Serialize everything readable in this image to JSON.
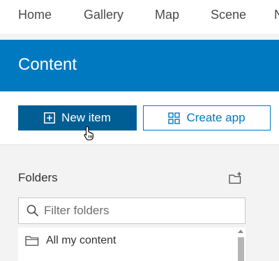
{
  "nav": {
    "items": [
      {
        "label": "Home"
      },
      {
        "label": "Gallery"
      },
      {
        "label": "Map"
      },
      {
        "label": "Scene"
      },
      {
        "label": "N"
      }
    ]
  },
  "banner": {
    "title": "Content"
  },
  "actions": {
    "new_item_label": "New item",
    "new_item_icon": "plus-square-icon",
    "create_app_label": "Create app",
    "create_app_icon": "grid-apps-icon"
  },
  "folders": {
    "heading": "Folders",
    "add_icon": "add-folder-icon",
    "filter_placeholder": "Filter folders",
    "filter_value": "",
    "items": [
      {
        "label": "All my content",
        "icon": "folder-icon"
      }
    ]
  },
  "colors": {
    "brand_blue": "#0079c1",
    "primary_button": "#005e95",
    "background": "#f3f3f3"
  }
}
